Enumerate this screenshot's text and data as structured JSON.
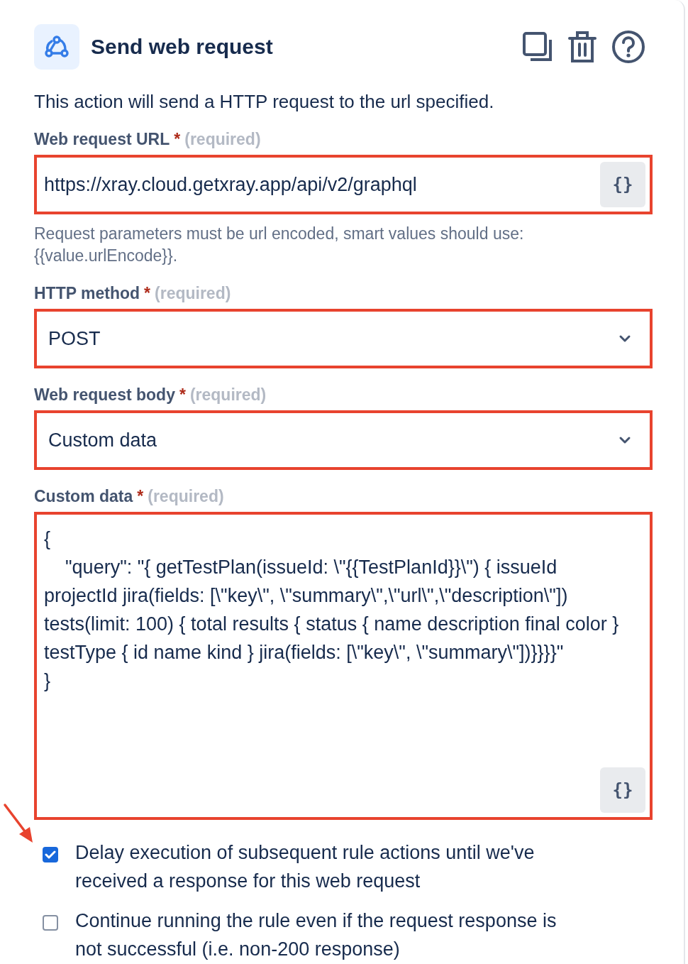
{
  "header": {
    "title": "Send web request"
  },
  "description": "This action will send a HTTP request to the url specified.",
  "fields": [
    {
      "kind": "text",
      "label": "Web request URL",
      "required_mark": "*",
      "required_note": "(required)",
      "value": "https://xray.cloud.getxray.app/api/v2/graphql",
      "smart_button": "{}",
      "highlighted": true,
      "help": "Request parameters must be url encoded, smart values should use: {{value.urlEncode}}."
    },
    {
      "kind": "select",
      "label": "HTTP method",
      "required_mark": "*",
      "required_note": "(required)",
      "value": "POST",
      "highlighted": true
    },
    {
      "kind": "select",
      "label": "Web request body",
      "required_mark": "*",
      "required_note": "(required)",
      "value": "Custom data",
      "highlighted": true
    },
    {
      "kind": "textarea",
      "label": "Custom data",
      "required_mark": "*",
      "required_note": "(required)",
      "value": "{\n    \"query\": \"{ getTestPlan(issueId: \\\"{{TestPlanId}}\\\") { issueId projectId jira(fields: [\\\"key\\\", \\\"summary\\\",\\\"url\\\",\\\"description\\\"]) tests(limit: 100) { total results { status { name description final color } testType { id name kind } jira(fields: [\\\"key\\\", \\\"summary\\\"])}}}}\"\n}",
      "smart_button": "{}",
      "highlighted": true
    }
  ],
  "options": [
    {
      "label": "Delay execution of subsequent rule actions until we've received a response for this web request",
      "checked": true,
      "pointed_at": true
    },
    {
      "label": "Continue running the rule even if the request response is not successful (i.e. non-200 response)",
      "checked": false,
      "pointed_at": false
    }
  ]
}
